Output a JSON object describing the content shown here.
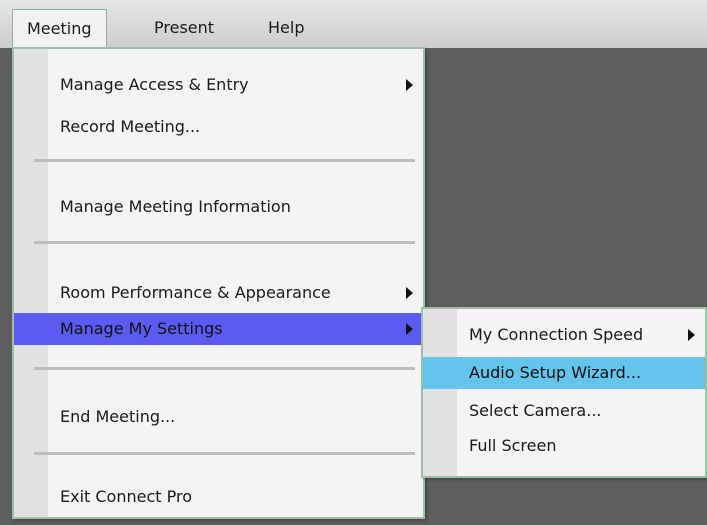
{
  "menubar": {
    "items": [
      {
        "label": "Meeting",
        "active": true
      },
      {
        "label": "Present",
        "active": false
      },
      {
        "label": "Help",
        "active": false
      }
    ]
  },
  "meeting_menu": {
    "items": [
      {
        "label": "Manage Access & Entry",
        "submenu": true
      },
      {
        "label": "Record Meeting...",
        "submenu": false
      },
      {
        "label": "Manage Meeting Information",
        "submenu": false
      },
      {
        "label": "Room Performance & Appearance",
        "submenu": true
      },
      {
        "label": "Manage My Settings",
        "submenu": true,
        "highlighted": true
      },
      {
        "label": "End Meeting...",
        "submenu": false
      },
      {
        "label": "Exit Connect Pro",
        "submenu": false
      }
    ]
  },
  "settings_submenu": {
    "items": [
      {
        "label": "My Connection Speed",
        "submenu": true
      },
      {
        "label": "Audio Setup Wizard...",
        "submenu": false,
        "highlighted": true
      },
      {
        "label": "Select Camera...",
        "submenu": false
      },
      {
        "label": "Full Screen",
        "submenu": false
      }
    ]
  },
  "colors": {
    "menu_highlight": "#5b5bf2",
    "submenu_highlight": "#64c4ec",
    "workspace": "#5e5e5e",
    "menu_border": "#9dbfa8"
  }
}
